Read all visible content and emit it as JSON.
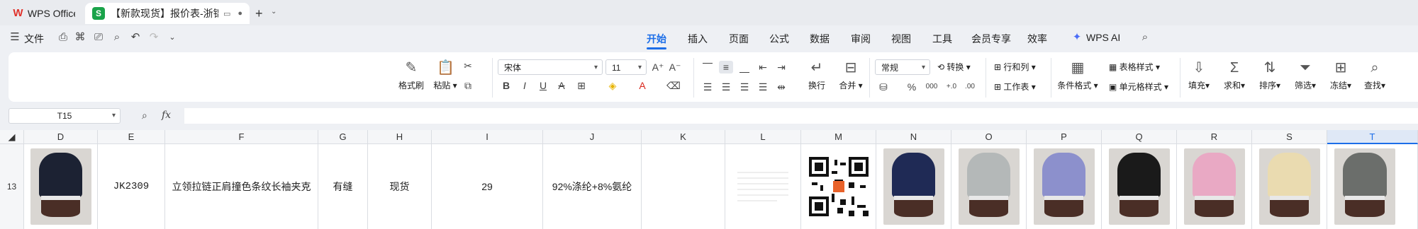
{
  "tabs": {
    "app_tab": "WPS Office",
    "doc_tab": "【新款现货】报价表-浙锦瑞恒"
  },
  "menu": {
    "file": "文件",
    "items": [
      "开始",
      "插入",
      "页面",
      "公式",
      "数据",
      "审阅",
      "视图",
      "工具",
      "会员专享",
      "效率"
    ],
    "wps_ai": "WPS AI"
  },
  "ribbon": {
    "format_painter": "格式刷",
    "paste": "粘贴",
    "font_name": "宋体",
    "font_size": "11",
    "wrap": "换行",
    "merge": "合并",
    "number_format": "常规",
    "convert": "转换",
    "rows_cols": "行和列",
    "worksheet": "工作表",
    "cond_format": "条件格式",
    "table_style": "表格样式",
    "cell_style": "单元格样式",
    "fill": "填充",
    "sum": "求和",
    "sort": "排序",
    "filter": "筛选",
    "freeze": "冻结",
    "find": "查找",
    "pct": "%",
    "thousands": "000"
  },
  "formula_bar": {
    "cell_ref": "T15",
    "fx": "fx"
  },
  "columns": [
    "D",
    "E",
    "F",
    "G",
    "H",
    "I",
    "J",
    "K",
    "L",
    "M",
    "N",
    "O",
    "P",
    "Q",
    "R",
    "S",
    "T"
  ],
  "row": {
    "number": "13",
    "style_no": "JK2309",
    "description": "立领拉链正肩撞色条纹长袖夹克",
    "seam": "有缝",
    "stock": "现货",
    "qty": "29",
    "fabric": "92%涤纶+8%氨纶"
  },
  "photos": [
    "#1c2233",
    "#1f2a55",
    "#b4b8b8",
    "#8c90cc",
    "#1a1a1a",
    "#e9a9c4",
    "#eadbb0",
    "#6b6e6b"
  ],
  "colors": {
    "accent": "#1c6ee8",
    "wps_red": "#e0322b",
    "sheet_green": "#1aa34a"
  }
}
